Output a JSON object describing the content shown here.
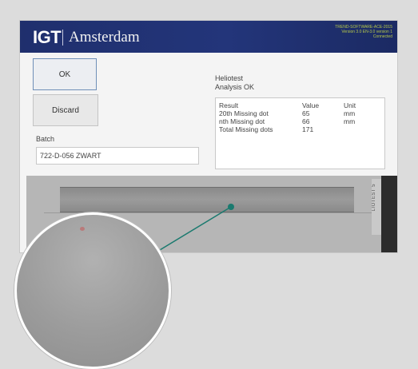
{
  "titlebar": {
    "logo": "IGT",
    "app_title": "Amsterdam",
    "version_line_1": "TREND-SOFTWARE-ACE-2015",
    "version_line_2": "Version 3.0 EN-3.0 version 1",
    "version_line_3": "Connected"
  },
  "actions": {
    "ok_label": "OK",
    "discard_label": "Discard"
  },
  "batch": {
    "label": "Batch",
    "value": "722-D-056 ZWART"
  },
  "status": {
    "line_1": "Heliotest",
    "line_2": "Analysis OK"
  },
  "results": {
    "headers": [
      "Result",
      "Value",
      "Unit"
    ],
    "rows": [
      [
        "20th Missing dot",
        "65",
        "mm"
      ],
      [
        "nth Missing dot",
        "66",
        "mm"
      ],
      [
        "Total Missing dots",
        "171",
        ""
      ]
    ]
  },
  "strip": {
    "tag": "LIOTEST 5"
  },
  "colors": {
    "titlebar": "#23357a",
    "version_text": "#b7c949",
    "marker": "#1b7a6f"
  }
}
